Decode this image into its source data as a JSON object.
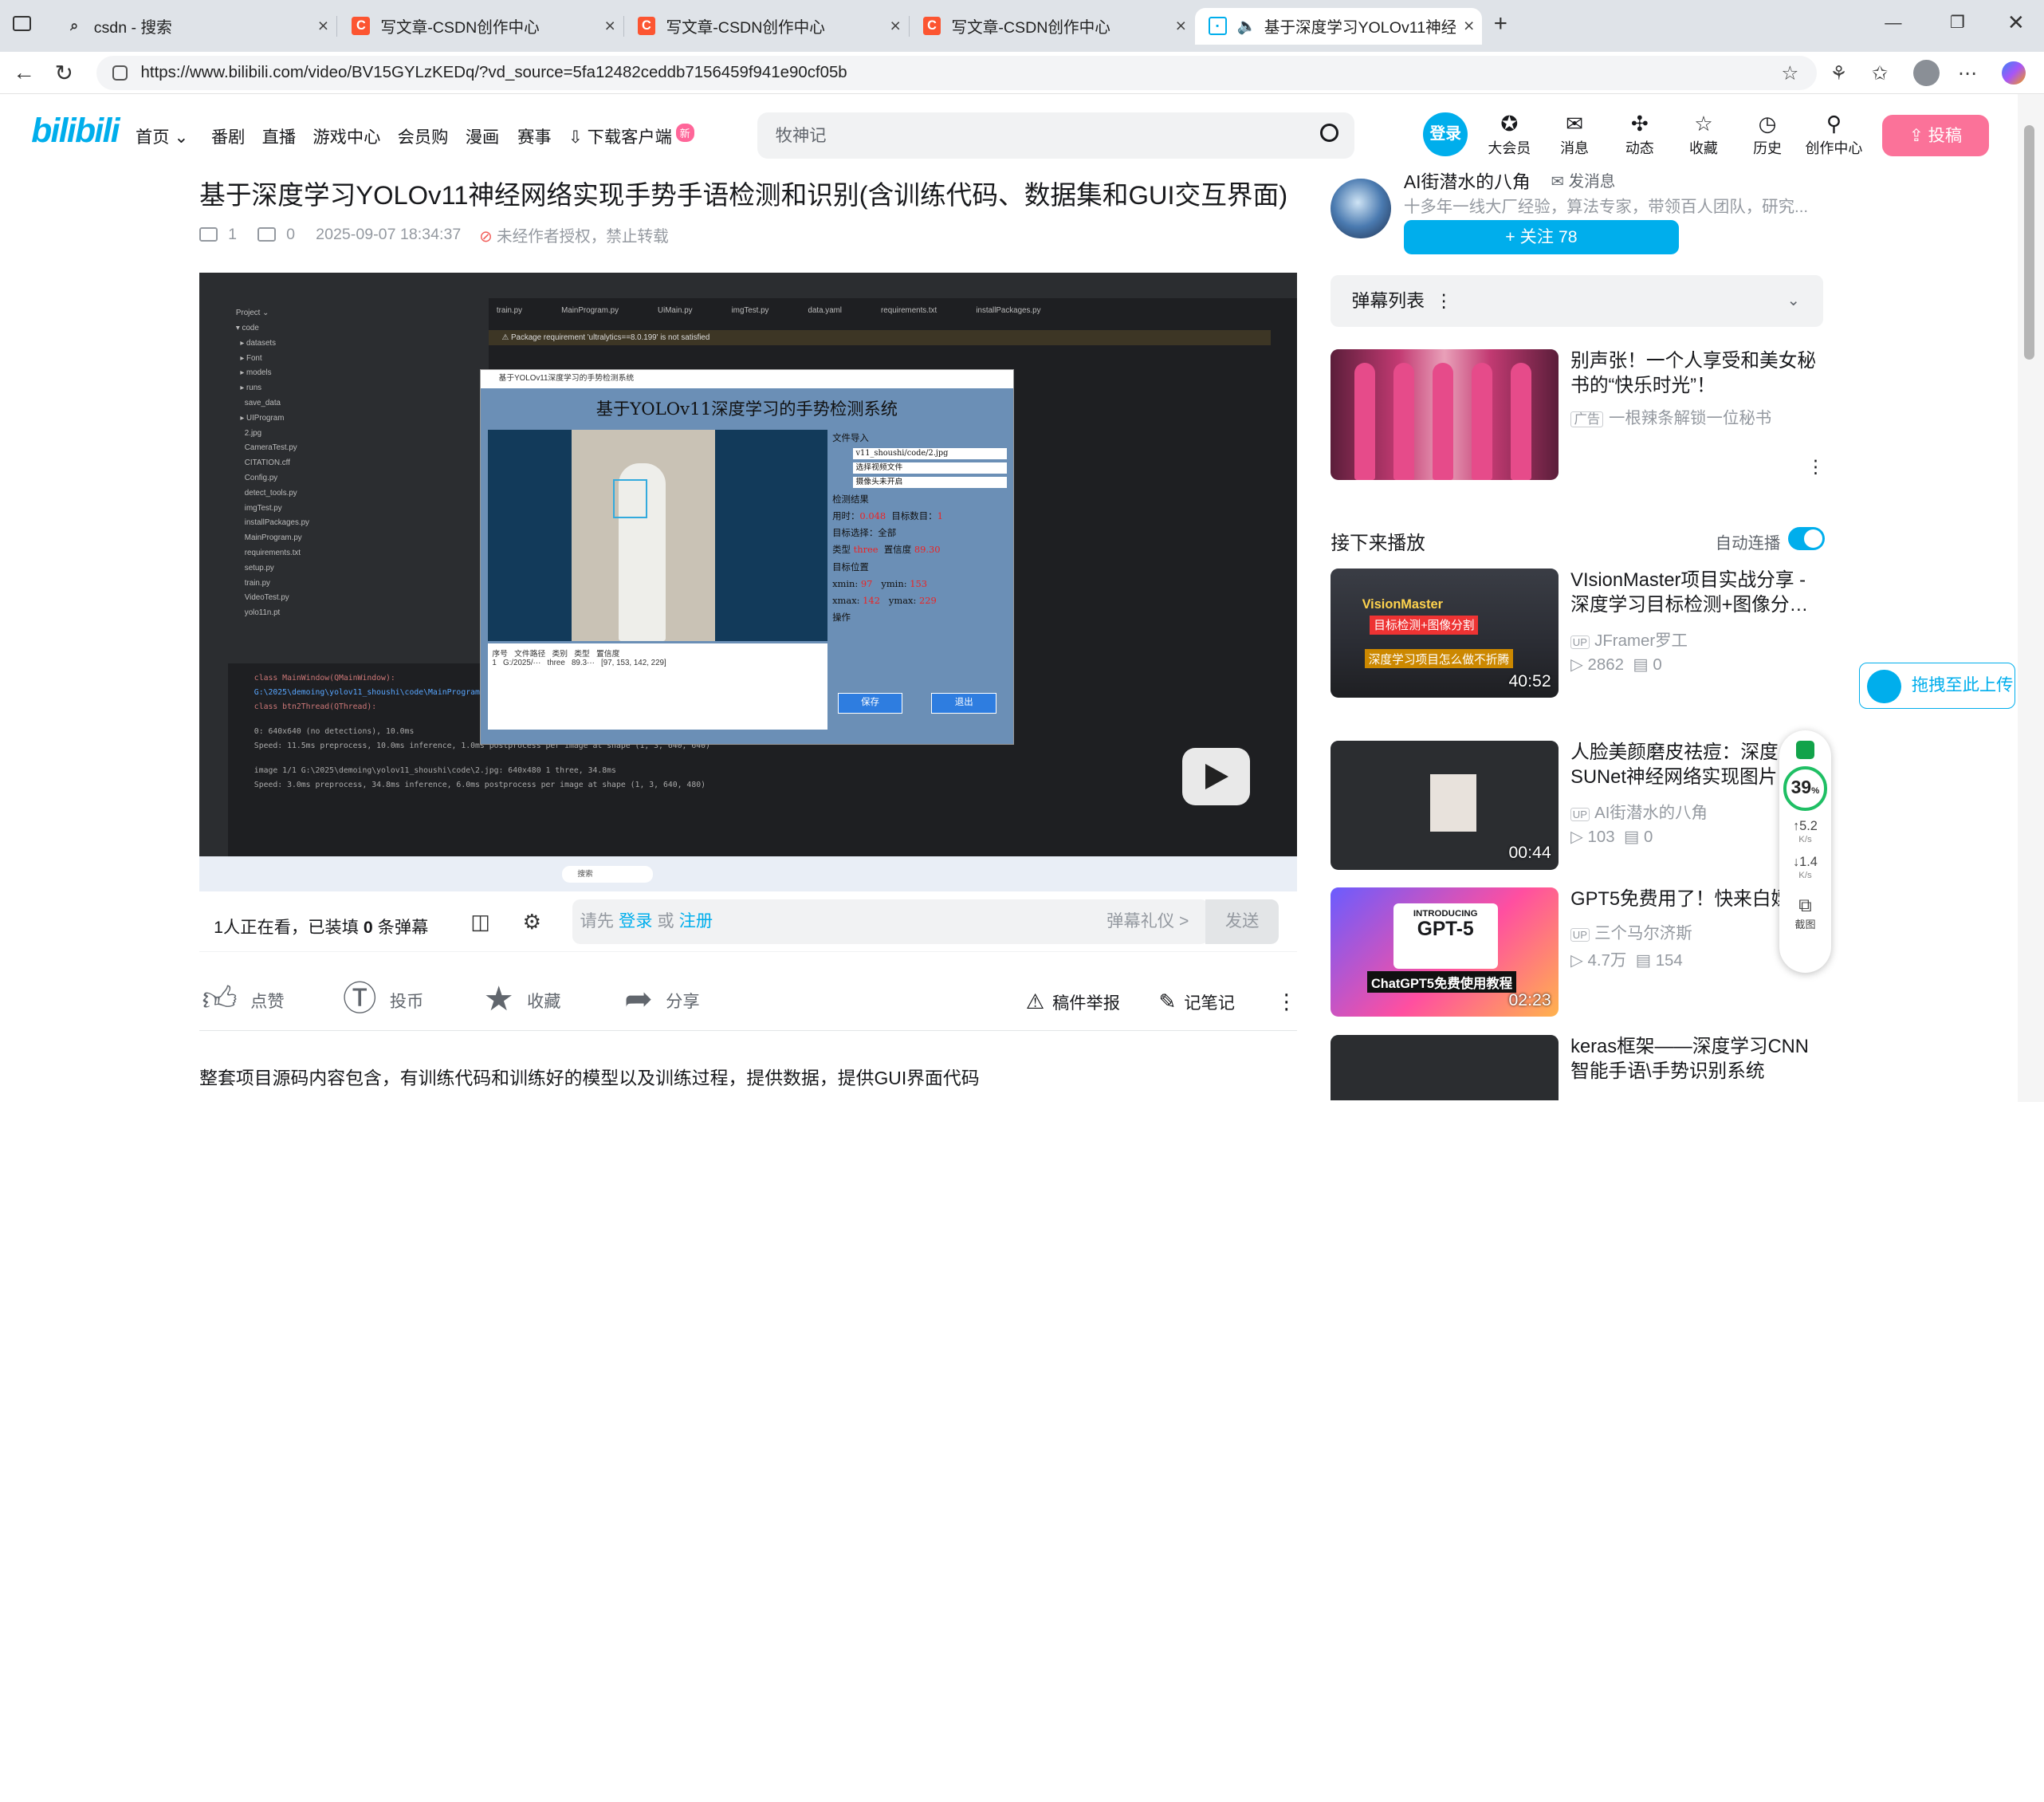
{
  "browser": {
    "tabs": [
      {
        "title": "csdn - 搜索",
        "favicon": "search-icon"
      },
      {
        "title": "写文章-CSDN创作中心",
        "favicon": "csdn-icon"
      },
      {
        "title": "写文章-CSDN创作中心",
        "favicon": "csdn-icon"
      },
      {
        "title": "写文章-CSDN创作中心",
        "favicon": "csdn-icon"
      },
      {
        "title": "基于深度学习YOLOv11神经网",
        "favicon": "bilibili-icon"
      }
    ],
    "url": "https://www.bilibili.com/video/BV15GYLzKEDq/?vd_source=5fa12482ceddb7156459f941e90cf05b"
  },
  "header": {
    "logo": "bilibili",
    "menu": [
      "首页",
      "番剧",
      "直播",
      "游戏中心",
      "会员购",
      "漫画",
      "赛事"
    ],
    "download": "下载客户端",
    "download_badge": "新",
    "search_placeholder": "牧神记",
    "login": "登录",
    "icons": [
      {
        "label": "大会员",
        "icon": "vip-icon"
      },
      {
        "label": "消息",
        "icon": "message-icon"
      },
      {
        "label": "动态",
        "icon": "dynamic-icon"
      },
      {
        "label": "收藏",
        "icon": "favorite-icon"
      },
      {
        "label": "历史",
        "icon": "history-icon"
      },
      {
        "label": "创作中心",
        "icon": "creator-icon"
      }
    ],
    "upload": "投稿"
  },
  "video": {
    "title": "基于深度学习YOLOv11神经网络实现手势手语检测和识别(含训练代码、数据集和GUI交互界面)",
    "views": "1",
    "danmaku_count": "0",
    "date": "2025-09-07 18:34:37",
    "copyright": "未经作者授权，禁止转载",
    "gui_title": "基于YOLOv11深度学习的手势检测系统",
    "gui_file_path": "v11_shoushi/code/2.jpg",
    "gui_time": "0.048",
    "gui_class": "three",
    "gui_conf": "89.30",
    "gui_xmin": "97",
    "gui_ymin": "153",
    "gui_xmax": "142",
    "gui_ymax": "229",
    "gui_save": "保存",
    "gui_exit": "退出",
    "console_lines": [
      "class MainWindow(QMainWindow):",
      "G:\\2025\\demoing\\yolov11_shoushi\\code\\MainProgram.py",
      "class btn2Thread(QThread):",
      "0: 640x640 (no detections), 10.0ms",
      "Speed: 11.5ms preprocess, 10.0ms inference, 1.0ms postprocess per image at shape (1, 3, 640, 640)",
      "image 1/1 G:\\2025\\demoing\\yolov11_shoushi\\code\\2.jpg: 640x480 1 three, 34.8ms",
      "Speed: 3.0ms preprocess, 34.8ms inference, 6.0ms postprocess per image at shape (1, 3, 640, 480)"
    ]
  },
  "sendbar": {
    "watching_prefix": "1人正在看，已装填",
    "watching_count": "0",
    "watching_suffix": "条弹幕",
    "placeholder_pre": "请先",
    "login": "登录",
    "or": "或",
    "register": "注册",
    "gift": "弹幕礼仪 >",
    "send": "发送"
  },
  "actions": {
    "like": "点赞",
    "coin": "投币",
    "fav": "收藏",
    "share": "分享",
    "report": "稿件举报",
    "notes": "记笔记"
  },
  "description": "整套项目源码内容包含，有训练代码和训练好的模型以及训练过程，提供数据，提供GUI界面代码",
  "uploader": {
    "name": "AI街潜水的八角",
    "msg": "发消息",
    "sign": "十多年一线大厂经验，算法专家，带领百人团队，研究...",
    "follow": "+ 关注 78"
  },
  "danmaku_list": "弹幕列表",
  "ad": {
    "title": "别声张！一个人享受和美女秘书的“快乐时光”！",
    "tag": "广告",
    "sub": "一根辣条解锁一位秘书"
  },
  "up_next": "接下来播放",
  "autoplay": "自动连播",
  "recommend": [
    {
      "title": "VIsionMaster项目实战分享 - 深度学习目标检测+图像分…",
      "up": "JFramer罗工",
      "views": "2862",
      "danmaku": "0",
      "duration": "40:52",
      "thumb_text": "深度学习项目怎么做不折腾"
    },
    {
      "title": "人脸美颜磨皮祛痘：深度 SUNet神经网络实现图片",
      "up": "AI街潜水的八角",
      "views": "103",
      "danmaku": "0",
      "duration": "00:44",
      "thumb_text": ""
    },
    {
      "title": "GPT5免费用了！快来白嫖",
      "up": "三个马尔济斯",
      "views": "4.7万",
      "danmaku": "154",
      "duration": "02:23",
      "thumb_text": "ChatGPT5免费使用教程"
    },
    {
      "title": "keras框架——深度学习CNN智能手语\\手势识别系统",
      "up": "",
      "views": "",
      "danmaku": "",
      "duration": "",
      "thumb_text": ""
    }
  ],
  "float_upload": "拖拽至此上传",
  "speed_widget": {
    "percent": "39",
    "up": "5.2",
    "down": "1.4",
    "unit": "K/s",
    "shot": "截图"
  }
}
